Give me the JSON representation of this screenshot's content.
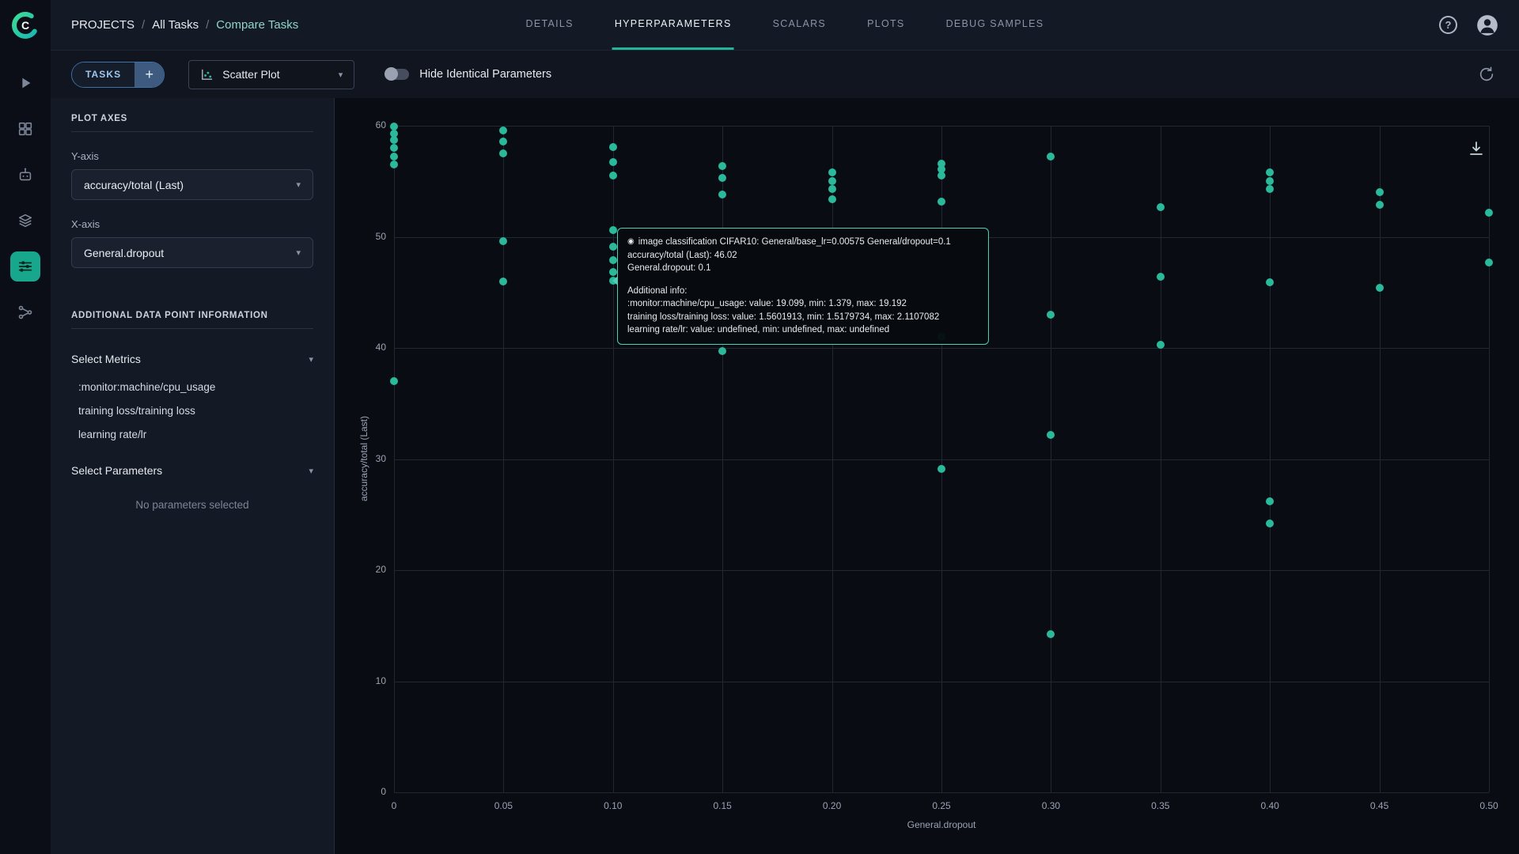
{
  "app": {
    "logo_letter": "C"
  },
  "header": {
    "breadcrumb": [
      "PROJECTS",
      "All Tasks",
      "Compare Tasks"
    ],
    "tabs": [
      {
        "label": "DETAILS",
        "active": false
      },
      {
        "label": "HYPERPARAMETERS",
        "active": true
      },
      {
        "label": "SCALARS",
        "active": false
      },
      {
        "label": "PLOTS",
        "active": false
      },
      {
        "label": "DEBUG SAMPLES",
        "active": false
      }
    ],
    "icons": {
      "help": "?"
    }
  },
  "toolbar": {
    "tasks_label": "TASKS",
    "plus": "+",
    "plot_type_value": "Scatter Plot",
    "toggle_label": "Hide Identical Parameters",
    "caret": "▾"
  },
  "sidebar": {
    "plot_axes_title": "PLOT AXES",
    "y_axis_label": "Y-axis",
    "y_axis_value": "accuracy/total (Last)",
    "x_axis_label": "X-axis",
    "x_axis_value": "General.dropout",
    "additional_title": "ADDITIONAL DATA POINT INFORMATION",
    "select_metrics_label": "Select Metrics",
    "metrics": [
      ":monitor:machine/cpu_usage",
      "training loss/training loss",
      "learning rate/lr"
    ],
    "select_parameters_label": "Select Parameters",
    "no_parameters_text": "No parameters selected",
    "caret": "▾"
  },
  "chart_data": {
    "type": "scatter",
    "title": "",
    "xlabel": "General.dropout",
    "ylabel": "accuracy/total (Last)",
    "xlim": [
      0,
      0.5
    ],
    "ylim": [
      0,
      60
    ],
    "grid": true,
    "point_color": "#2ab99a",
    "x_ticks": [
      {
        "value": 0,
        "label": "0"
      },
      {
        "value": 0.05,
        "label": "0.05"
      },
      {
        "value": 0.1,
        "label": "0.10"
      },
      {
        "value": 0.15,
        "label": "0.15"
      },
      {
        "value": 0.2,
        "label": "0.20"
      },
      {
        "value": 0.25,
        "label": "0.25"
      },
      {
        "value": 0.3,
        "label": "0.30"
      },
      {
        "value": 0.35,
        "label": "0.35"
      },
      {
        "value": 0.4,
        "label": "0.40"
      },
      {
        "value": 0.45,
        "label": "0.45"
      },
      {
        "value": 0.5,
        "label": "0.50"
      }
    ],
    "y_ticks": [
      0,
      10,
      20,
      30,
      40,
      50,
      60
    ],
    "points": [
      [
        0,
        59.9
      ],
      [
        0,
        59.3
      ],
      [
        0,
        58.7
      ],
      [
        0,
        58.0
      ],
      [
        0,
        57.2
      ],
      [
        0,
        56.5
      ],
      [
        0,
        37.0
      ],
      [
        0.05,
        59.6
      ],
      [
        0.05,
        58.6
      ],
      [
        0.05,
        57.5
      ],
      [
        0.05,
        49.6
      ],
      [
        0.05,
        46.0
      ],
      [
        0.1,
        58.1
      ],
      [
        0.1,
        56.7
      ],
      [
        0.1,
        55.5
      ],
      [
        0.1,
        50.6
      ],
      [
        0.1,
        49.1
      ],
      [
        0.1,
        47.9
      ],
      [
        0.1,
        46.8
      ],
      [
        0.1,
        46.02
      ],
      [
        0.15,
        56.4
      ],
      [
        0.15,
        55.3
      ],
      [
        0.15,
        53.8
      ],
      [
        0.15,
        39.7
      ],
      [
        0.2,
        55.8
      ],
      [
        0.2,
        55.0
      ],
      [
        0.2,
        54.3
      ],
      [
        0.2,
        53.4
      ],
      [
        0.25,
        56.6
      ],
      [
        0.25,
        56.1
      ],
      [
        0.25,
        55.5
      ],
      [
        0.25,
        53.2
      ],
      [
        0.25,
        41.0
      ],
      [
        0.25,
        29.1
      ],
      [
        0.3,
        57.2
      ],
      [
        0.3,
        43.0
      ],
      [
        0.3,
        32.2
      ],
      [
        0.3,
        14.2
      ],
      [
        0.35,
        52.7
      ],
      [
        0.35,
        46.4
      ],
      [
        0.35,
        40.3
      ],
      [
        0.4,
        55.8
      ],
      [
        0.4,
        55.0
      ],
      [
        0.4,
        54.3
      ],
      [
        0.4,
        45.9
      ],
      [
        0.4,
        26.2
      ],
      [
        0.4,
        24.2
      ],
      [
        0.45,
        54.0
      ],
      [
        0.45,
        52.9
      ],
      [
        0.45,
        45.4
      ],
      [
        0.5,
        52.2
      ],
      [
        0.5,
        47.7
      ]
    ]
  },
  "tooltip": {
    "marker": "◉",
    "title": "image classification CIFAR10: General/base_lr=0.00575 General/dropout=0.1",
    "y_line": "accuracy/total (Last): 46.02",
    "x_line": "General.dropout: 0.1",
    "additional_label": "Additional info:",
    "additional": [
      ":monitor:machine/cpu_usage: value: 19.099, min: 1.379, max: 19.192",
      "training loss/training loss: value: 1.5601913, min: 1.5179734, max: 2.1107082",
      "learning rate/lr: value: undefined, min: undefined, max: undefined"
    ]
  }
}
